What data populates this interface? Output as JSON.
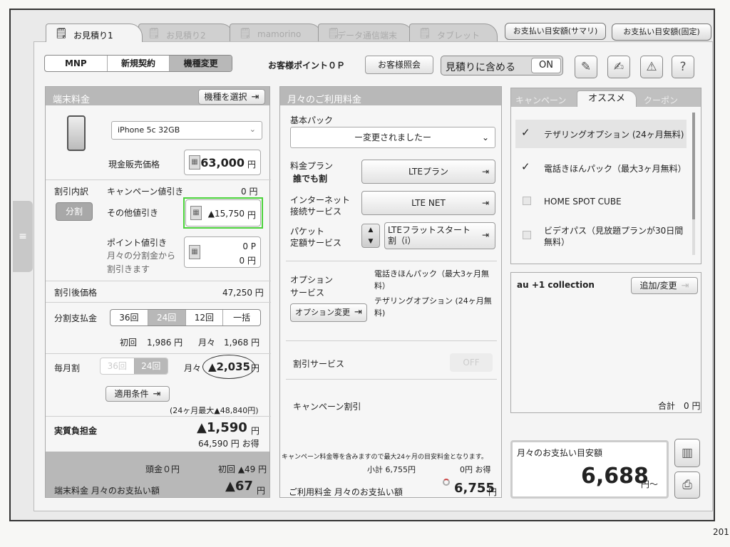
{
  "tabs": [
    "お見積り1",
    "お見積り2",
    "mamorino",
    "データ通信端末",
    "タブレット"
  ],
  "top_buttons": {
    "summary": "お支払い目安額(サマリ)",
    "fixed": "お支払い目安額(固定)"
  },
  "contract": [
    "MNP",
    "新規契約",
    "機種変更"
  ],
  "points": "お客様ポイント０Ｐ",
  "lookup": "お客様照会",
  "include": {
    "label": "見積りに含める",
    "value": "ON"
  },
  "device": {
    "header": "端末料金",
    "select_btn": "機種を選択",
    "model": "iPhone 5c 32GB",
    "cash_label": "現金販売価格",
    "cash_value": "63,000",
    "yen": "円"
  },
  "discount": {
    "title": "割引内訳",
    "bunkatsu": "分割",
    "campaign_label": "キャンペーン値引き",
    "campaign_value": "0 円",
    "other_label": "その他値引き",
    "other_value": "▲15,750",
    "point_label": "ポイント値引き",
    "point_note1": "月々の分割金から",
    "point_note2": "割引きます",
    "point_p": "0 P",
    "point_yen": "0 円"
  },
  "after_price": {
    "label": "割引後価格",
    "value": "47,250 円"
  },
  "installment": {
    "label": "分割支払金",
    "options": [
      "36回",
      "24回",
      "12回",
      "一括"
    ],
    "first_label": "初回",
    "first_value": "1,986 円",
    "monthly_label": "月々",
    "monthly_value": "1,968 円"
  },
  "maitsuki": {
    "label": "毎月割",
    "opt1": "36回",
    "opt2": "24回",
    "monthly_label": "月々",
    "value": "▲2,035",
    "yen": "円",
    "cond_btn": "適用条件",
    "max_note": "(24ヶ月最大▲48,840円)"
  },
  "effective": {
    "label": "実質負担金",
    "value": "▲1,590",
    "yen": "円",
    "note": "64,590 円 お得"
  },
  "device_footer": {
    "head": "頭金０円",
    "first": "初回 ▲49 円",
    "label": "端末料金 月々のお支払い額",
    "value": "▲67",
    "yen": "円"
  },
  "monthly": {
    "header": "月々のご利用料金",
    "basic_label": "基本パック",
    "basic_value": "ー変更されましたー",
    "plan_label": "料金プラン",
    "plan_sub": "誰でも割",
    "plan_value": "LTEプラン",
    "net_label1": "インターネット",
    "net_label2": "接続サービス",
    "net_value": "LTE NET",
    "packet_label1": "パケット",
    "packet_label2": "定額サービス",
    "packet_value": "LTEフラットスタート割（i）",
    "option_label1": "オプション",
    "option_label2": "サービス",
    "option_btn": "オプション変更",
    "option_text1": "電話きほんパック（最大3ヶ月無料）",
    "option_text2": "テザリングオプション (24ヶ月無料)",
    "discount_service": "割引サービス",
    "off": "OFF",
    "campaign": "キャンペーン割引",
    "note": "キャンペーン料金等を含みますので最大24ヶ月の目安料金となります。",
    "subtotal": "小計 6,755円",
    "otoku": "0円 お得",
    "footer_label": "ご利用料金 月々のお支払い額",
    "footer_value": "6,755",
    "yen": "円"
  },
  "right_tabs": [
    "キャンペーン",
    "オススメ",
    "クーポン"
  ],
  "recommend": [
    {
      "text": "テザリングオプション (24ヶ月無料)",
      "checked": true
    },
    {
      "text": "電話きほんパック（最大3ヶ月無料）",
      "checked": true
    },
    {
      "text": "HOME SPOT CUBE",
      "checked": false
    },
    {
      "text": "ビデオパス（見放題プランが30日間無料）",
      "checked": false
    }
  ],
  "collection": {
    "title": "au +1 collection",
    "btn": "追加/変更",
    "total": "合計　0 円"
  },
  "payment": {
    "label": "月々のお支払い目安額",
    "value": "6,688",
    "suffix": "円〜"
  },
  "page_number": "201"
}
